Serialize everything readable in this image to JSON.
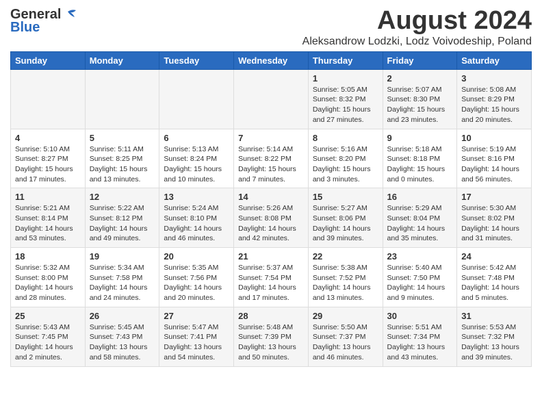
{
  "header": {
    "logo_general": "General",
    "logo_blue": "Blue",
    "month_title": "August 2024",
    "location": "Aleksandrow Lodzki, Lodz Voivodeship, Poland"
  },
  "days_of_week": [
    "Sunday",
    "Monday",
    "Tuesday",
    "Wednesday",
    "Thursday",
    "Friday",
    "Saturday"
  ],
  "weeks": [
    {
      "days": [
        {
          "number": "",
          "info": ""
        },
        {
          "number": "",
          "info": ""
        },
        {
          "number": "",
          "info": ""
        },
        {
          "number": "",
          "info": ""
        },
        {
          "number": "1",
          "info": "Sunrise: 5:05 AM\nSunset: 8:32 PM\nDaylight: 15 hours\nand 27 minutes."
        },
        {
          "number": "2",
          "info": "Sunrise: 5:07 AM\nSunset: 8:30 PM\nDaylight: 15 hours\nand 23 minutes."
        },
        {
          "number": "3",
          "info": "Sunrise: 5:08 AM\nSunset: 8:29 PM\nDaylight: 15 hours\nand 20 minutes."
        }
      ]
    },
    {
      "days": [
        {
          "number": "4",
          "info": "Sunrise: 5:10 AM\nSunset: 8:27 PM\nDaylight: 15 hours\nand 17 minutes."
        },
        {
          "number": "5",
          "info": "Sunrise: 5:11 AM\nSunset: 8:25 PM\nDaylight: 15 hours\nand 13 minutes."
        },
        {
          "number": "6",
          "info": "Sunrise: 5:13 AM\nSunset: 8:24 PM\nDaylight: 15 hours\nand 10 minutes."
        },
        {
          "number": "7",
          "info": "Sunrise: 5:14 AM\nSunset: 8:22 PM\nDaylight: 15 hours\nand 7 minutes."
        },
        {
          "number": "8",
          "info": "Sunrise: 5:16 AM\nSunset: 8:20 PM\nDaylight: 15 hours\nand 3 minutes."
        },
        {
          "number": "9",
          "info": "Sunrise: 5:18 AM\nSunset: 8:18 PM\nDaylight: 15 hours\nand 0 minutes."
        },
        {
          "number": "10",
          "info": "Sunrise: 5:19 AM\nSunset: 8:16 PM\nDaylight: 14 hours\nand 56 minutes."
        }
      ]
    },
    {
      "days": [
        {
          "number": "11",
          "info": "Sunrise: 5:21 AM\nSunset: 8:14 PM\nDaylight: 14 hours\nand 53 minutes."
        },
        {
          "number": "12",
          "info": "Sunrise: 5:22 AM\nSunset: 8:12 PM\nDaylight: 14 hours\nand 49 minutes."
        },
        {
          "number": "13",
          "info": "Sunrise: 5:24 AM\nSunset: 8:10 PM\nDaylight: 14 hours\nand 46 minutes."
        },
        {
          "number": "14",
          "info": "Sunrise: 5:26 AM\nSunset: 8:08 PM\nDaylight: 14 hours\nand 42 minutes."
        },
        {
          "number": "15",
          "info": "Sunrise: 5:27 AM\nSunset: 8:06 PM\nDaylight: 14 hours\nand 39 minutes."
        },
        {
          "number": "16",
          "info": "Sunrise: 5:29 AM\nSunset: 8:04 PM\nDaylight: 14 hours\nand 35 minutes."
        },
        {
          "number": "17",
          "info": "Sunrise: 5:30 AM\nSunset: 8:02 PM\nDaylight: 14 hours\nand 31 minutes."
        }
      ]
    },
    {
      "days": [
        {
          "number": "18",
          "info": "Sunrise: 5:32 AM\nSunset: 8:00 PM\nDaylight: 14 hours\nand 28 minutes."
        },
        {
          "number": "19",
          "info": "Sunrise: 5:34 AM\nSunset: 7:58 PM\nDaylight: 14 hours\nand 24 minutes."
        },
        {
          "number": "20",
          "info": "Sunrise: 5:35 AM\nSunset: 7:56 PM\nDaylight: 14 hours\nand 20 minutes."
        },
        {
          "number": "21",
          "info": "Sunrise: 5:37 AM\nSunset: 7:54 PM\nDaylight: 14 hours\nand 17 minutes."
        },
        {
          "number": "22",
          "info": "Sunrise: 5:38 AM\nSunset: 7:52 PM\nDaylight: 14 hours\nand 13 minutes."
        },
        {
          "number": "23",
          "info": "Sunrise: 5:40 AM\nSunset: 7:50 PM\nDaylight: 14 hours\nand 9 minutes."
        },
        {
          "number": "24",
          "info": "Sunrise: 5:42 AM\nSunset: 7:48 PM\nDaylight: 14 hours\nand 5 minutes."
        }
      ]
    },
    {
      "days": [
        {
          "number": "25",
          "info": "Sunrise: 5:43 AM\nSunset: 7:45 PM\nDaylight: 14 hours\nand 2 minutes."
        },
        {
          "number": "26",
          "info": "Sunrise: 5:45 AM\nSunset: 7:43 PM\nDaylight: 13 hours\nand 58 minutes."
        },
        {
          "number": "27",
          "info": "Sunrise: 5:47 AM\nSunset: 7:41 PM\nDaylight: 13 hours\nand 54 minutes."
        },
        {
          "number": "28",
          "info": "Sunrise: 5:48 AM\nSunset: 7:39 PM\nDaylight: 13 hours\nand 50 minutes."
        },
        {
          "number": "29",
          "info": "Sunrise: 5:50 AM\nSunset: 7:37 PM\nDaylight: 13 hours\nand 46 minutes."
        },
        {
          "number": "30",
          "info": "Sunrise: 5:51 AM\nSunset: 7:34 PM\nDaylight: 13 hours\nand 43 minutes."
        },
        {
          "number": "31",
          "info": "Sunrise: 5:53 AM\nSunset: 7:32 PM\nDaylight: 13 hours\nand 39 minutes."
        }
      ]
    }
  ]
}
